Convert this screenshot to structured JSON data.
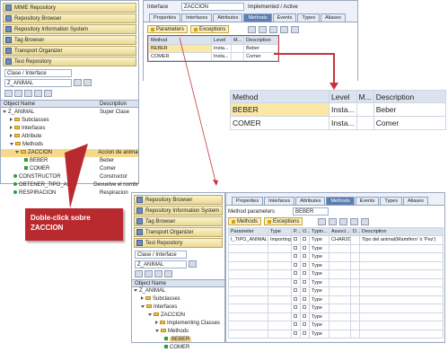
{
  "top_left": {
    "menu": [
      "MIME Repository",
      "Repository Browser",
      "Repository Information System",
      "Tag Browser",
      "Transport Organizer",
      "Test Repository"
    ],
    "object_type": "Clase / Interface",
    "object_name": "Z_ANIMAL",
    "columns": [
      "Object Name",
      "Description"
    ],
    "tree": [
      {
        "label": "Z_ANIMAL",
        "desc": "Super Clase",
        "kind": "root"
      },
      {
        "label": "Subclasses",
        "desc": "",
        "kind": "folder"
      },
      {
        "label": "Interfaces",
        "desc": "",
        "kind": "folder"
      },
      {
        "label": "Attribute",
        "desc": "",
        "kind": "folder"
      },
      {
        "label": "Methods",
        "desc": "",
        "kind": "folder-open"
      },
      {
        "label": "ZACCION",
        "desc": "Accion de animal",
        "kind": "selected"
      },
      {
        "label": "BEBER",
        "desc": "Beber",
        "kind": "method"
      },
      {
        "label": "COMER",
        "desc": "Comer",
        "kind": "method"
      },
      {
        "label": "CONSTRUCTOR",
        "desc": "Constructor",
        "kind": "method-g"
      },
      {
        "label": "OBTENER_TIPO_ANIM",
        "desc": "Devuelve el nombre",
        "kind": "method-g"
      },
      {
        "label": "RESPIRACION",
        "desc": "Respiracion",
        "kind": "method-g"
      }
    ]
  },
  "top_right": {
    "interface_label": "Interface",
    "interface_value": "ZACCION",
    "status": "Implemented / Active",
    "tabs": [
      "Properties",
      "Interfaces",
      "Attributes",
      "Methods",
      "Events",
      "Types",
      "Aliases"
    ],
    "active_tab": "Methods",
    "buttons": [
      "Parameters",
      "Exceptions"
    ],
    "columns": [
      "Method",
      "Level",
      "M...",
      "Description"
    ],
    "rows": [
      {
        "method": "BEBER",
        "level": "Insta...",
        "desc": "Beber"
      },
      {
        "method": "COMER",
        "level": "Insta...",
        "desc": "Comer"
      }
    ]
  },
  "zoom": {
    "columns": [
      "Method",
      "Level",
      "M...",
      "Description"
    ],
    "rows": [
      {
        "method": "BEBER",
        "level": "Insta...",
        "desc": "Beber"
      },
      {
        "method": "COMER",
        "level": "Insta...",
        "desc": "Comer"
      }
    ]
  },
  "callout": {
    "text_line1": "Doble-click sobre",
    "text_line2": "ZACCION"
  },
  "bottom_left": {
    "menu": [
      "Repository Browser",
      "Repository Information System",
      "Tag Browser",
      "Transport Organizer",
      "Test Repository"
    ],
    "object_type": "Clase / Interface",
    "object_name": "Z_ANIMAL",
    "columns": [
      "Object Name"
    ],
    "tree": [
      {
        "label": "Z_ANIMAL",
        "kind": "root"
      },
      {
        "label": "Subclasses",
        "kind": "folder"
      },
      {
        "label": "Interfaces",
        "kind": "folder-open"
      },
      {
        "label": "ZACCION",
        "kind": "folder-open"
      },
      {
        "label": "Implementing Classes",
        "kind": "folder"
      },
      {
        "label": "Methods",
        "kind": "folder-open"
      },
      {
        "label": "BEBER",
        "kind": "selected-method"
      },
      {
        "label": "COMER",
        "kind": "method"
      }
    ]
  },
  "bottom_right": {
    "tabs": [
      "Properties",
      "Interfaces",
      "Attributes",
      "Methods",
      "Events",
      "Types",
      "Aliases"
    ],
    "active_tab": "Methods",
    "method_params_label": "Method parameters",
    "method_params_value": "BEBER",
    "buttons": [
      "Methods",
      "Exceptions"
    ],
    "columns": [
      "Parameter",
      "Type",
      "P...",
      "O...",
      "Typin...",
      "Associ...",
      "D...",
      "Description"
    ],
    "rows": [
      {
        "param": "I_TIPO_ANIMAL",
        "type": "Importing",
        "p": "",
        "o": "",
        "typing": "Type",
        "assoc": "CHAR20",
        "d": "",
        "desc": "Tipo del animal(Mamifero' ó 'Pez')"
      },
      {
        "param": "",
        "type": "",
        "p": "",
        "o": "",
        "typing": "Type",
        "assoc": "",
        "d": "",
        "desc": ""
      },
      {
        "param": "",
        "type": "",
        "p": "",
        "o": "",
        "typing": "Type",
        "assoc": "",
        "d": "",
        "desc": ""
      },
      {
        "param": "",
        "type": "",
        "p": "",
        "o": "",
        "typing": "Type",
        "assoc": "",
        "d": "",
        "desc": ""
      },
      {
        "param": "",
        "type": "",
        "p": "",
        "o": "",
        "typing": "Type",
        "assoc": "",
        "d": "",
        "desc": ""
      },
      {
        "param": "",
        "type": "",
        "p": "",
        "o": "",
        "typing": "Type",
        "assoc": "",
        "d": "",
        "desc": ""
      },
      {
        "param": "",
        "type": "",
        "p": "",
        "o": "",
        "typing": "Type",
        "assoc": "",
        "d": "",
        "desc": ""
      },
      {
        "param": "",
        "type": "",
        "p": "",
        "o": "",
        "typing": "Type",
        "assoc": "",
        "d": "",
        "desc": ""
      },
      {
        "param": "",
        "type": "",
        "p": "",
        "o": "",
        "typing": "Type",
        "assoc": "",
        "d": "",
        "desc": ""
      },
      {
        "param": "",
        "type": "",
        "p": "",
        "o": "",
        "typing": "Type",
        "assoc": "",
        "d": "",
        "desc": ""
      },
      {
        "param": "",
        "type": "",
        "p": "",
        "o": "",
        "typing": "Type",
        "assoc": "",
        "d": "",
        "desc": ""
      },
      {
        "param": "",
        "type": "",
        "p": "",
        "o": "",
        "typing": "Type",
        "assoc": "",
        "d": "",
        "desc": ""
      }
    ]
  },
  "colors": {
    "accent_red": "#c8323a",
    "callout_red": "#b92a2f",
    "selection": "#fbe8a6",
    "tab_active": "#5d7db3"
  }
}
